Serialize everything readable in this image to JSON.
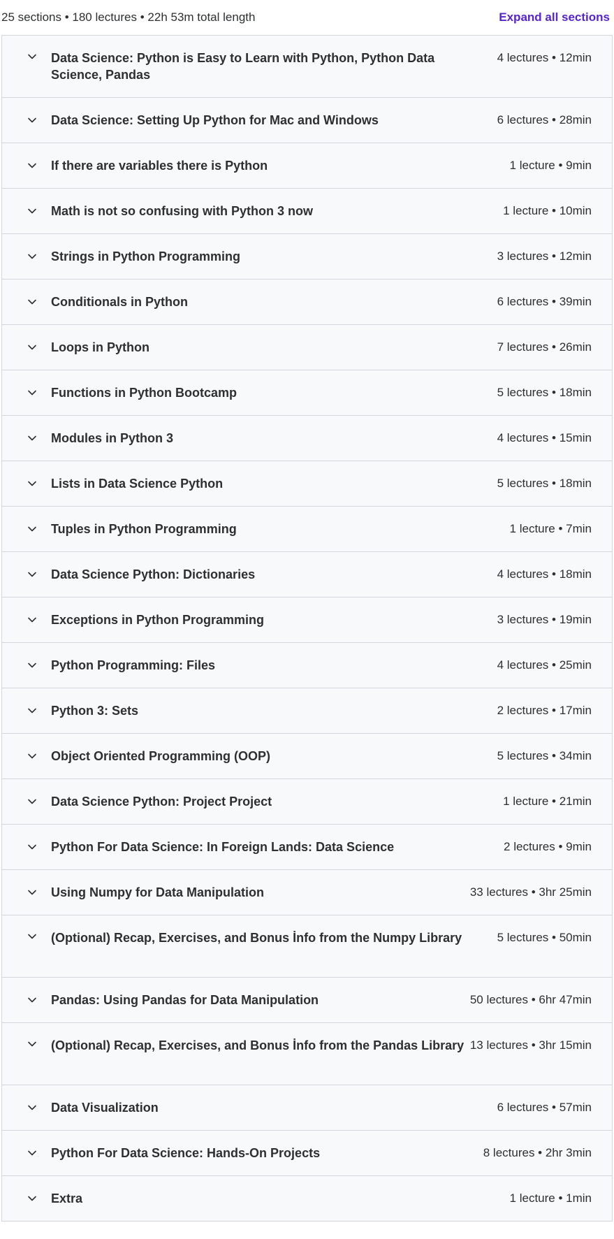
{
  "header": {
    "summary": "25 sections • 180 lectures • 22h 53m total length",
    "expand_label": "Expand all sections"
  },
  "icons": {
    "section_toggle": "chevron-down-icon"
  },
  "colors": {
    "accent": "#5624d0",
    "section_bg": "#f7f9fa",
    "border": "#d1d7dc",
    "text": "#2d2f31"
  },
  "sections": [
    {
      "title": "Data Science: Python is Easy to Learn with Python, Python Data Science, Pandas",
      "meta": "4 lectures • 12min"
    },
    {
      "title": "Data Science: Setting Up Python for Mac and Windows",
      "meta": "6 lectures • 28min"
    },
    {
      "title": "If there are variables there is Python",
      "meta": "1 lecture • 9min"
    },
    {
      "title": "Math is not so confusing with Python 3 now",
      "meta": "1 lecture • 10min"
    },
    {
      "title": "Strings in Python Programming",
      "meta": "3 lectures • 12min"
    },
    {
      "title": "Conditionals in Python",
      "meta": "6 lectures • 39min"
    },
    {
      "title": "Loops in Python",
      "meta": "7 lectures • 26min"
    },
    {
      "title": "Functions in Python Bootcamp",
      "meta": "5 lectures • 18min"
    },
    {
      "title": "Modules in Python 3",
      "meta": "4 lectures • 15min"
    },
    {
      "title": "Lists in Data Science Python",
      "meta": "5 lectures • 18min"
    },
    {
      "title": "Tuples in Python Programming",
      "meta": "1 lecture • 7min"
    },
    {
      "title": "Data Science Python: Dictionaries",
      "meta": "4 lectures • 18min"
    },
    {
      "title": "Exceptions in Python Programming",
      "meta": "3 lectures • 19min"
    },
    {
      "title": "Python Programming: Files",
      "meta": "4 lectures • 25min"
    },
    {
      "title": "Python 3: Sets",
      "meta": "2 lectures • 17min"
    },
    {
      "title": "Object Oriented Programming (OOP)",
      "meta": "5 lectures • 34min"
    },
    {
      "title": "Data Science Python: Project Project",
      "meta": "1 lecture • 21min"
    },
    {
      "title": "Python For Data Science: In Foreign Lands: Data Science",
      "meta": "2 lectures • 9min"
    },
    {
      "title": "Using Numpy for Data Manipulation",
      "meta": "33 lectures • 3hr 25min"
    },
    {
      "title": "(Optional) Recap, Exercises, and Bonus İnfo from the Numpy Library",
      "meta": "5 lectures • 50min"
    },
    {
      "title": "Pandas: Using Pandas for Data Manipulation",
      "meta": "50 lectures • 6hr 47min"
    },
    {
      "title": "(Optional) Recap, Exercises, and Bonus İnfo from the Pandas Library",
      "meta": "13 lectures • 3hr 15min"
    },
    {
      "title": "Data Visualization",
      "meta": "6 lectures • 57min"
    },
    {
      "title": "Python For Data Science: Hands-On Projects",
      "meta": "8 lectures • 2hr 3min"
    },
    {
      "title": "Extra",
      "meta": "1 lecture • 1min"
    }
  ]
}
